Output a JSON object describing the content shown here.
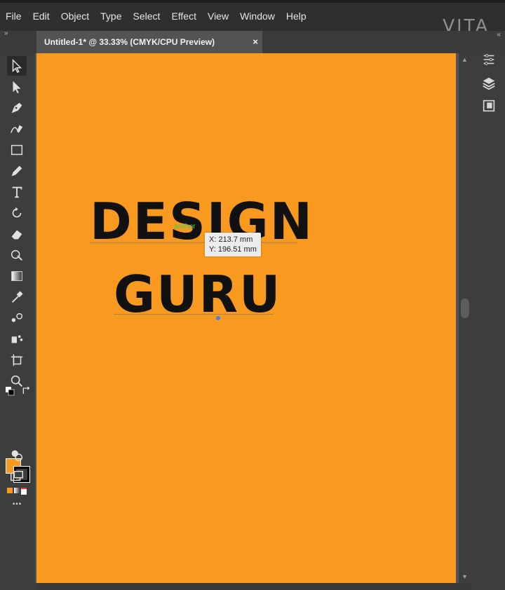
{
  "menu": {
    "items": [
      "File",
      "Edit",
      "Object",
      "Type",
      "Select",
      "Effect",
      "View",
      "Window",
      "Help"
    ],
    "brand": "VITA"
  },
  "document": {
    "tab_label": "Untitled-1* @ 33.33% (CMYK/CPU Preview)",
    "close_glyph": "×",
    "collapse_left": "»",
    "collapse_right": "«"
  },
  "tools": [
    {
      "name": "selection-tool",
      "icon": "arrow-outline-icon",
      "selected": true
    },
    {
      "name": "direct-selection-tool",
      "icon": "arrow-solid-icon"
    },
    {
      "name": "pen-tool",
      "icon": "pen-icon"
    },
    {
      "name": "curvature-tool",
      "icon": "curvature-pen-icon"
    },
    {
      "name": "rectangle-tool",
      "icon": "rectangle-icon"
    },
    {
      "name": "pencil-tool",
      "icon": "pencil-icon"
    },
    {
      "name": "type-tool",
      "icon": "type-icon",
      "glyph": "T"
    },
    {
      "name": "rotate-tool",
      "icon": "rotate-icon"
    },
    {
      "name": "eraser-tool",
      "icon": "eraser-icon"
    },
    {
      "name": "shape-builder-tool",
      "icon": "shape-builder-icon"
    },
    {
      "name": "gradient-tool",
      "icon": "gradient-icon"
    },
    {
      "name": "eyedropper-tool",
      "icon": "eyedropper-icon"
    },
    {
      "name": "blend-tool",
      "icon": "blend-icon"
    },
    {
      "name": "symbol-sprayer-tool",
      "icon": "symbol-sprayer-icon"
    },
    {
      "name": "artboard-tool",
      "icon": "artboard-icon"
    },
    {
      "name": "zoom-tool",
      "icon": "zoom-icon"
    }
  ],
  "colors": {
    "artboard": "#f99a20",
    "fill": "#f99a20",
    "stroke": "#000000",
    "ui_dark": "#3d3d3d",
    "canvas": "#535353",
    "anchor_hint": "#39d35a"
  },
  "artwork": {
    "line1": "DESIGN",
    "line2": "GURU",
    "anchor_hint": "anchor",
    "cursor_x": "X: 213.7 mm",
    "cursor_y": "Y: 196.51 mm"
  },
  "toolbar_more": "...",
  "right_panel": [
    "properties-icon",
    "layers-icon",
    "libraries-icon"
  ]
}
